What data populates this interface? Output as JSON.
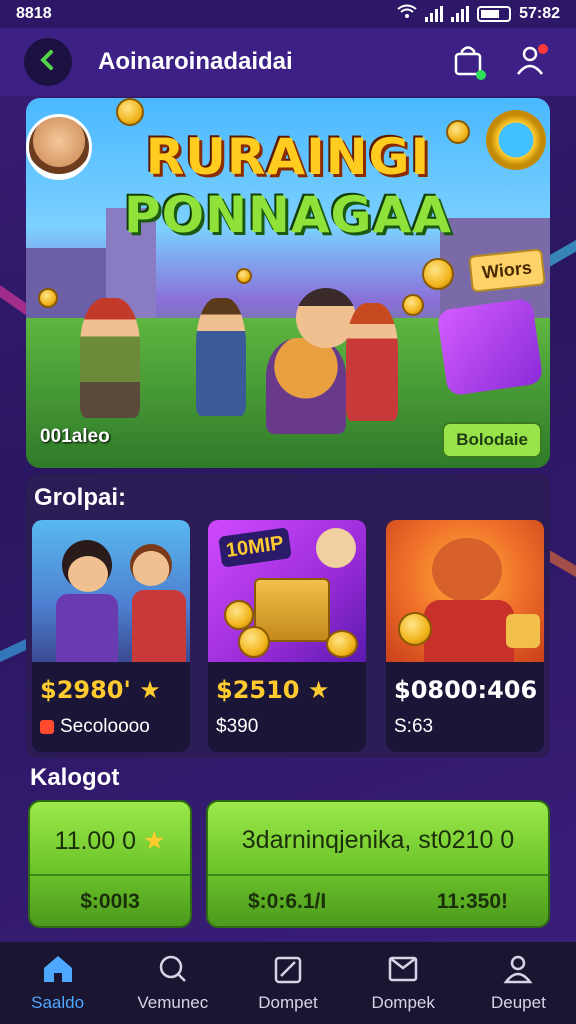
{
  "status_bar": {
    "time": "8818",
    "battery_text": "57:82"
  },
  "header": {
    "title": "Aoinaroinadaidai"
  },
  "hero": {
    "title_line1": "RURAINGI",
    "title_line2": "PONNAGAA",
    "ribbon_label": "Wiors",
    "bottom_left_label": "001aleo",
    "button_label": "Bolodaie"
  },
  "section1": {
    "title": "Grolpai:",
    "cards": [
      {
        "price": "$2980'",
        "subtitle": "Secoloooo"
      },
      {
        "price": "$2510",
        "subtitle": "$390",
        "image_text": "10MIP"
      },
      {
        "price": "$0800:406",
        "subtitle": "S:63"
      }
    ]
  },
  "section2": {
    "title": "Kalogot",
    "buttons": [
      {
        "top_label": "11.00 0",
        "bottom_label": "$:00I3"
      },
      {
        "top_label": "3darninqjenika, st0210 0",
        "bottom_left": "$:0:6.1/I",
        "bottom_right": "11:350!"
      }
    ]
  },
  "bottom_nav": [
    {
      "label": "Saaldo",
      "icon": "home-icon",
      "active": true
    },
    {
      "label": "Vemunec",
      "icon": "search-icon",
      "active": false
    },
    {
      "label": "Dompet",
      "icon": "pencil-square-icon",
      "active": false
    },
    {
      "label": "Dompek",
      "icon": "book-icon",
      "active": false
    },
    {
      "label": "Deupet",
      "icon": "user-icon",
      "active": false
    }
  ],
  "colors": {
    "background": "#2a1660",
    "header": "#3c2085",
    "accent_green": "#8ee23a",
    "accent_gold": "#ffcb2e",
    "nav_active": "#4fa8ff"
  }
}
